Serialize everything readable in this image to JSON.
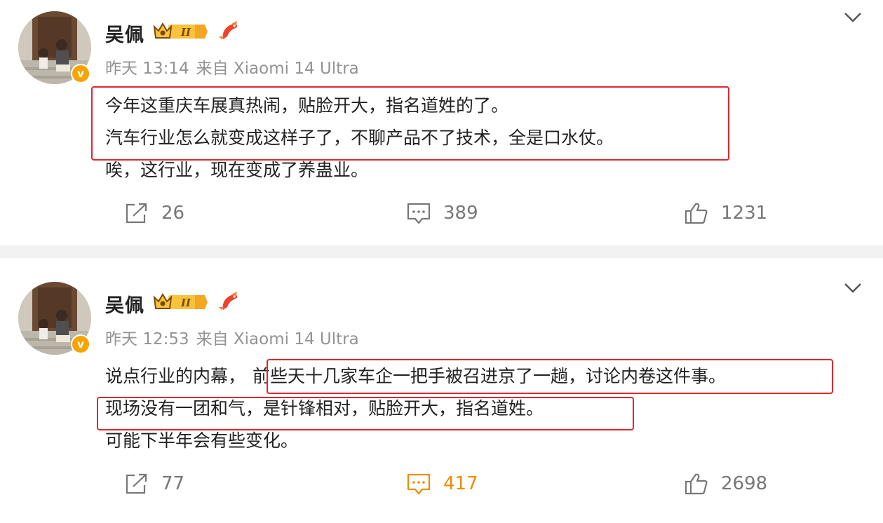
{
  "posts": [
    {
      "author": "吴佩",
      "level_badge": "II",
      "verified_mark": "v",
      "time": "昨天 13:14",
      "source": "来自 Xiaomi 14 Ultra",
      "lines": [
        "今年这重庆车展真热闹，贴脸开大，指名道姓的了。",
        "汽车行业怎么就变成这样子了，不聊产品不了技术，全是口水仗。",
        "唉，这行业，现在变成了养蛊业。"
      ],
      "repost_count": "26",
      "comment_count": "389",
      "like_count": "1231",
      "comment_active": false
    },
    {
      "author": "吴佩",
      "level_badge": "II",
      "verified_mark": "v",
      "time": "昨天 12:53",
      "source": "来自 Xiaomi 14 Ultra",
      "lines": [
        "说点行业的内幕，",
        "前些天十几家车企一把手被召进京了一趟，讨论内卷这件事。",
        "现场没有一团和气，是针锋相对，贴脸开大，指名道姓。",
        "可能下半年会有些变化。"
      ],
      "repost_count": "77",
      "comment_count": "417",
      "like_count": "2698",
      "comment_active": true
    }
  ],
  "icons": {
    "repost": "repost-icon",
    "comment": "comment-icon",
    "like": "like-icon",
    "more": "chevron-down-icon",
    "crown": "crown-icon",
    "koi": "koi-icon",
    "verified": "verified-icon"
  },
  "colors": {
    "highlight_box": "#e0262d",
    "meta_gray": "#939393",
    "action_gray": "#777777",
    "active_orange": "#f08c00",
    "verified_yellow": "#f7a400",
    "divider": "#f2f2f2"
  }
}
